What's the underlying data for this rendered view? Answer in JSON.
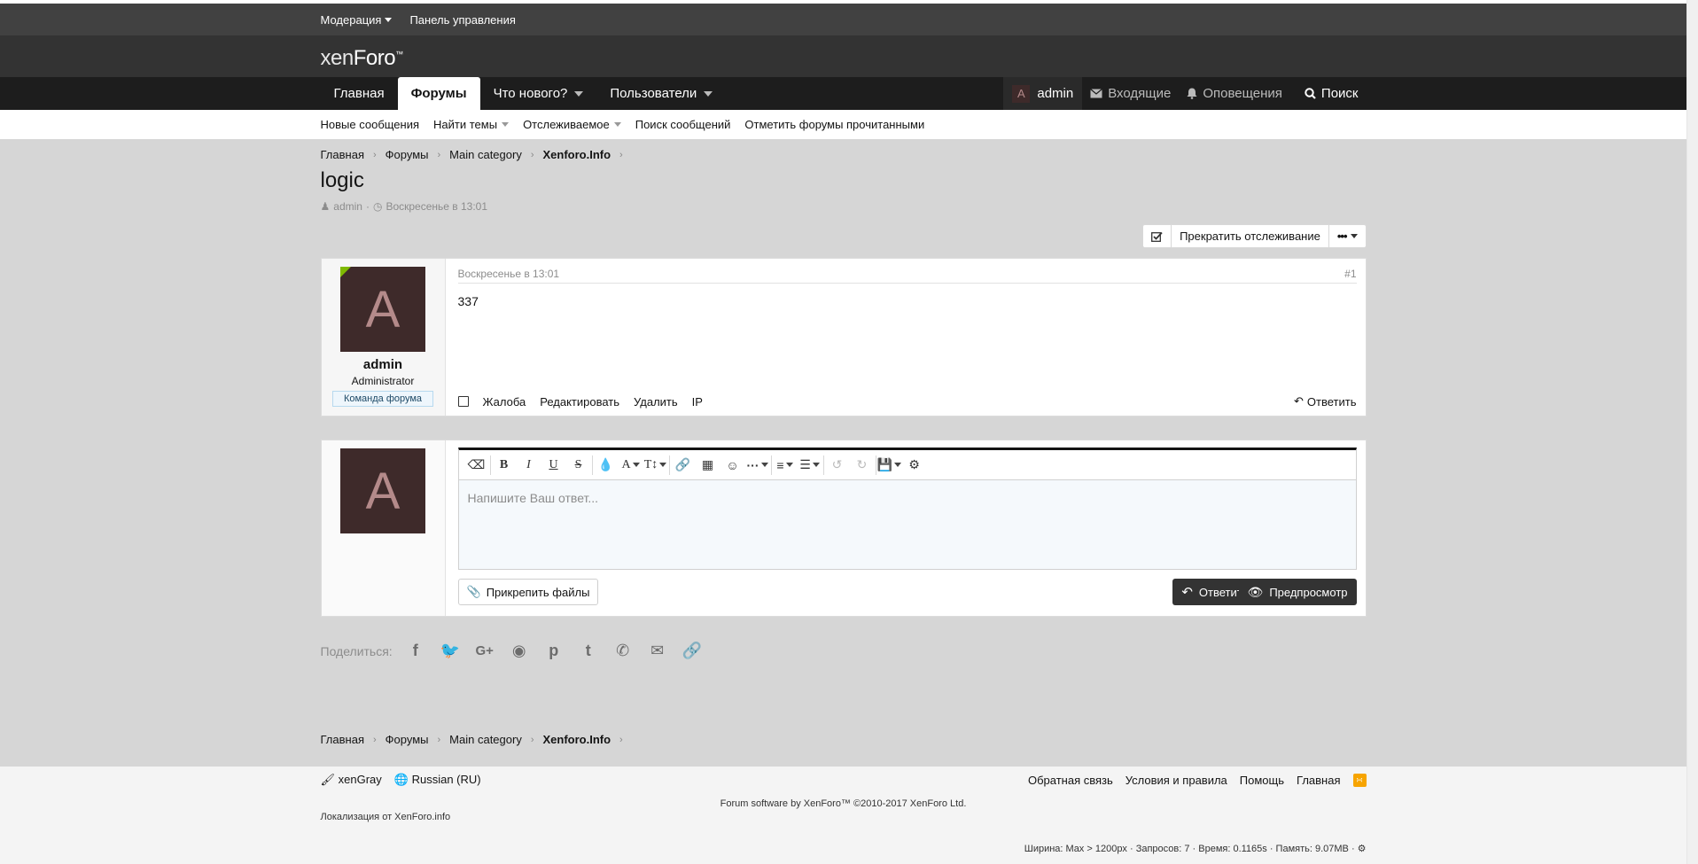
{
  "staffbar": {
    "moderation": "Модерация",
    "admin_panel": "Панель управления"
  },
  "logo": {
    "part1": "xen",
    "part2": "Foro"
  },
  "nav": {
    "tabs": [
      {
        "label": "Главная"
      },
      {
        "label": "Форумы"
      },
      {
        "label": "Что нового?"
      },
      {
        "label": "Пользователи"
      }
    ],
    "user_initial": "A",
    "user_name": "admin",
    "inbox": "Входящие",
    "alerts": "Оповещения",
    "search": "Поиск"
  },
  "subnav": {
    "items": [
      "Новые сообщения",
      "Найти темы",
      "Отслеживаемое",
      "Поиск сообщений",
      "Отметить форумы прочитанными"
    ]
  },
  "breadcrumb": [
    "Главная",
    "Форумы",
    "Main category",
    "Xenforo.Info"
  ],
  "thread": {
    "title": "logic",
    "author": "admin",
    "date": "Воскресенье в 13:01",
    "watch_label": "Прекратить отслеживание"
  },
  "post": {
    "avatar_initial": "A",
    "username": "admin",
    "user_title": "Administrator",
    "banner": "Команда форума",
    "date": "Воскресенье в 13:01",
    "number": "#1",
    "content": "337",
    "actions": [
      "Жалоба",
      "Редактировать",
      "Удалить",
      "IP"
    ],
    "reply": "Ответить"
  },
  "quick_reply": {
    "avatar_initial": "A",
    "placeholder": "Напишите Ваш ответ...",
    "attach": "Прикрепить файлы",
    "reply": "Ответить",
    "preview": "Предпросмотр"
  },
  "share": {
    "label": "Поделиться:"
  },
  "footer": {
    "style": "xenGray",
    "language": "Russian (RU)",
    "links": [
      "Обратная связь",
      "Условия и правила",
      "Помощь",
      "Главная"
    ],
    "copyright": "Forum software by XenForo™ ©2010-2017 XenForo Ltd.",
    "localization": "Локализация от XenForo.info",
    "stats": "Ширина: Max > 1200px · Запросов: 7 · Время: 0.1165s · Память: 9.07MB ·"
  },
  "colors": {
    "accent_dark": "#1d1d1d",
    "header": "#333333",
    "body_bg": "#d6d6d6",
    "avatar_bg": "#3e2a2a",
    "online": "#7fb900",
    "rss": "#f7a400"
  }
}
